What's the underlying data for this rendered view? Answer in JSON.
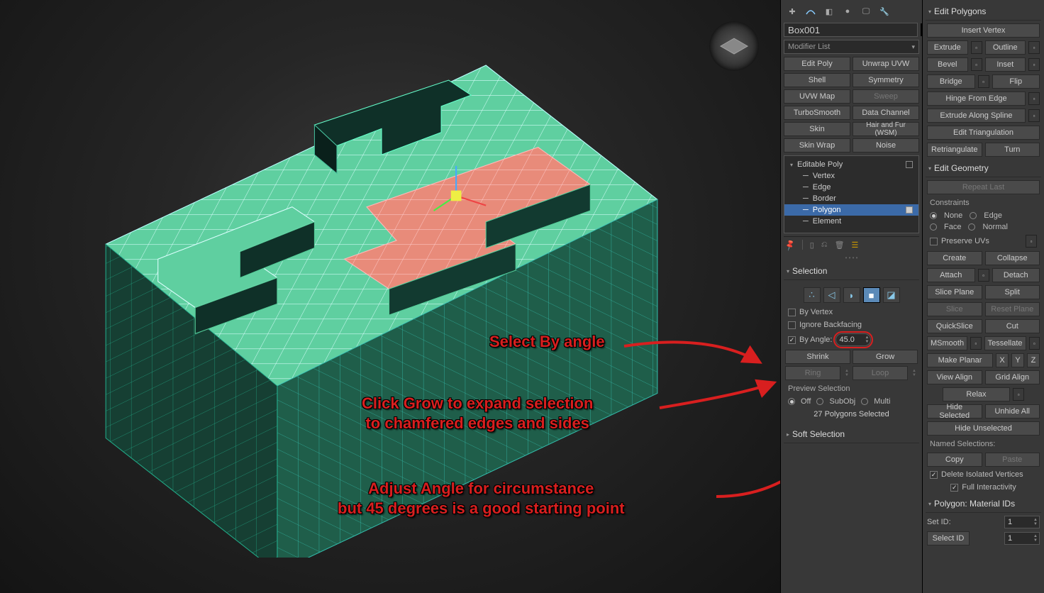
{
  "object_name": "Box001",
  "modifier_dropdown": "Modifier List",
  "modifier_buttons": [
    "Edit Poly",
    "Unwrap UVW",
    "Shell",
    "Symmetry",
    "UVW Map",
    "Sweep",
    "TurboSmooth",
    "Data Channel",
    "Skin",
    "Hair and Fur (WSM)",
    "Skin Wrap",
    "Noise"
  ],
  "stack": {
    "root": "Editable Poly",
    "levels": [
      "Vertex",
      "Edge",
      "Border",
      "Polygon",
      "Element"
    ],
    "selected": "Polygon"
  },
  "selection": {
    "header": "Selection",
    "by_vertex": "By Vertex",
    "ignore_backfacing": "Ignore Backfacing",
    "by_angle": "By Angle:",
    "angle_value": "45.0",
    "shrink": "Shrink",
    "grow": "Grow",
    "ring": "Ring",
    "loop": "Loop",
    "preview": "Preview Selection",
    "off": "Off",
    "subobj": "SubObj",
    "multi": "Multi",
    "count": "27 Polygons Selected"
  },
  "soft_selection": "Soft Selection",
  "edit_polygons": {
    "header": "Edit Polygons",
    "insert_vertex": "Insert Vertex",
    "extrude": "Extrude",
    "outline": "Outline",
    "bevel": "Bevel",
    "inset": "Inset",
    "bridge": "Bridge",
    "flip": "Flip",
    "hinge": "Hinge From Edge",
    "extrude_spline": "Extrude Along Spline",
    "edit_tri": "Edit Triangulation",
    "retri": "Retriangulate",
    "turn": "Turn"
  },
  "edit_geometry": {
    "header": "Edit Geometry",
    "repeat": "Repeat Last",
    "constraints": "Constraints",
    "none": "None",
    "edge": "Edge",
    "face": "Face",
    "normal": "Normal",
    "preserve_uvs": "Preserve UVs",
    "create": "Create",
    "collapse": "Collapse",
    "attach": "Attach",
    "detach": "Detach",
    "slice_plane": "Slice Plane",
    "split": "Split",
    "slice": "Slice",
    "reset_plane": "Reset Plane",
    "quickslice": "QuickSlice",
    "cut": "Cut",
    "msmooth": "MSmooth",
    "tessellate": "Tessellate",
    "make_planar": "Make Planar",
    "x": "X",
    "y": "Y",
    "z": "Z",
    "view_align": "View Align",
    "grid_align": "Grid Align",
    "relax": "Relax",
    "hide_sel": "Hide Selected",
    "unhide": "Unhide All",
    "hide_unsel": "Hide Unselected",
    "named_sel": "Named Selections:",
    "copy": "Copy",
    "paste": "Paste",
    "del_iso": "Delete Isolated Vertices",
    "full_int": "Full Interactivity"
  },
  "material_ids": {
    "header": "Polygon: Material IDs",
    "set_id": "Set ID:",
    "set_val": "1",
    "select_id": "Select ID",
    "sel_val": "1"
  },
  "annotations": {
    "a1": "Select By angle",
    "a2": "Click Grow to expand selection\nto chamfered edges and sides",
    "a3": "Adjust Angle for circumstance\nbut 45 degrees is a good starting point"
  }
}
